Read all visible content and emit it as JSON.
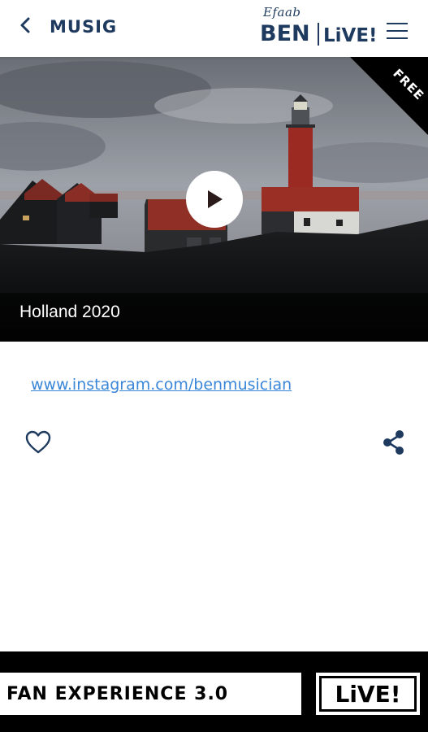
{
  "colors": {
    "brand_navy": "#1e3a5f",
    "link_blue": "#3a86d8",
    "footer_bg": "#000000"
  },
  "header": {
    "back_icon": "chevron-left-icon",
    "title": "MUSIG",
    "brand": {
      "script": "Efaab",
      "name": "BEN",
      "live": "LiVE!"
    },
    "menu_icon": "hamburger-menu-icon"
  },
  "video": {
    "badge": "FREE",
    "title": "Holland 2020",
    "play_icon": "play-icon"
  },
  "content": {
    "link": "www.instagram.com/benmusician",
    "like_icon": "heart-icon",
    "share_icon": "share-icon"
  },
  "footer": {
    "banner": "FAN EXPERIENCE 3.0",
    "live": "LiVE!"
  }
}
